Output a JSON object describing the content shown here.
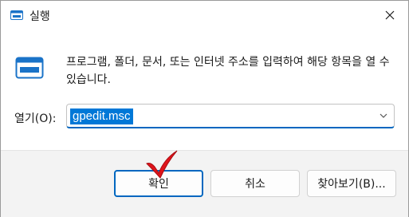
{
  "window": {
    "title": "실행",
    "icon": "run-icon"
  },
  "description": "프로그램, 폴더, 문서, 또는 인터넷 주소를 입력하여 해당 항목을 열 수 있습니다.",
  "open_label": "열기(O):",
  "combo": {
    "value": "gpedit.msc"
  },
  "buttons": {
    "ok": "확인",
    "cancel": "취소",
    "browse": "찾아보기(B)..."
  },
  "colors": {
    "accent": "#0067c0",
    "selection": "#0078d7",
    "checkmark": "#e0141b"
  }
}
